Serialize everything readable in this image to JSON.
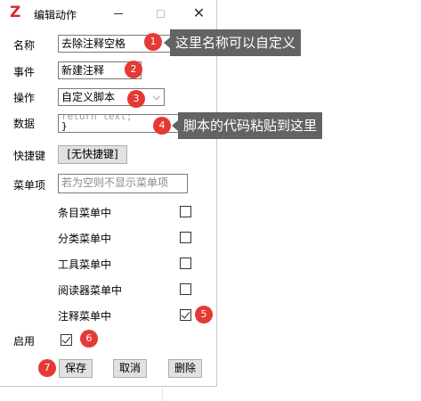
{
  "window": {
    "title": "编辑动作",
    "logo": "Z",
    "minimize": "minimize-icon",
    "maximize": "maximize-icon",
    "close": "✕"
  },
  "form": {
    "name_label": "名称",
    "name_value": "去除注释空格",
    "event_label": "事件",
    "event_value": "新建注释",
    "operation_label": "操作",
    "operation_value": "自定义脚本",
    "data_label": "数据",
    "data_line1": "return text;",
    "data_line2": "}",
    "shortcut_label": "快捷键",
    "shortcut_button": "[无快捷键]",
    "menu_label": "菜单项",
    "menu_placeholder": "若为空则不显示菜单项",
    "menus": [
      {
        "label": "条目菜单中",
        "checked": false
      },
      {
        "label": "分类菜单中",
        "checked": false
      },
      {
        "label": "工具菜单中",
        "checked": false
      },
      {
        "label": "阅读器菜单中",
        "checked": false
      },
      {
        "label": "注释菜单中",
        "checked": true
      }
    ],
    "enable_label": "启用",
    "enable_checked": true,
    "save_button": "保存",
    "cancel_button": "取消",
    "delete_button": "删除"
  },
  "annotations": {
    "badges": [
      "1",
      "2",
      "3",
      "4",
      "5",
      "6",
      "7"
    ],
    "callout1": "这里名称可以自定义",
    "callout4": "脚本的代码粘贴到这里",
    "badge_color": "#e53935",
    "callout_color": "#636363"
  }
}
